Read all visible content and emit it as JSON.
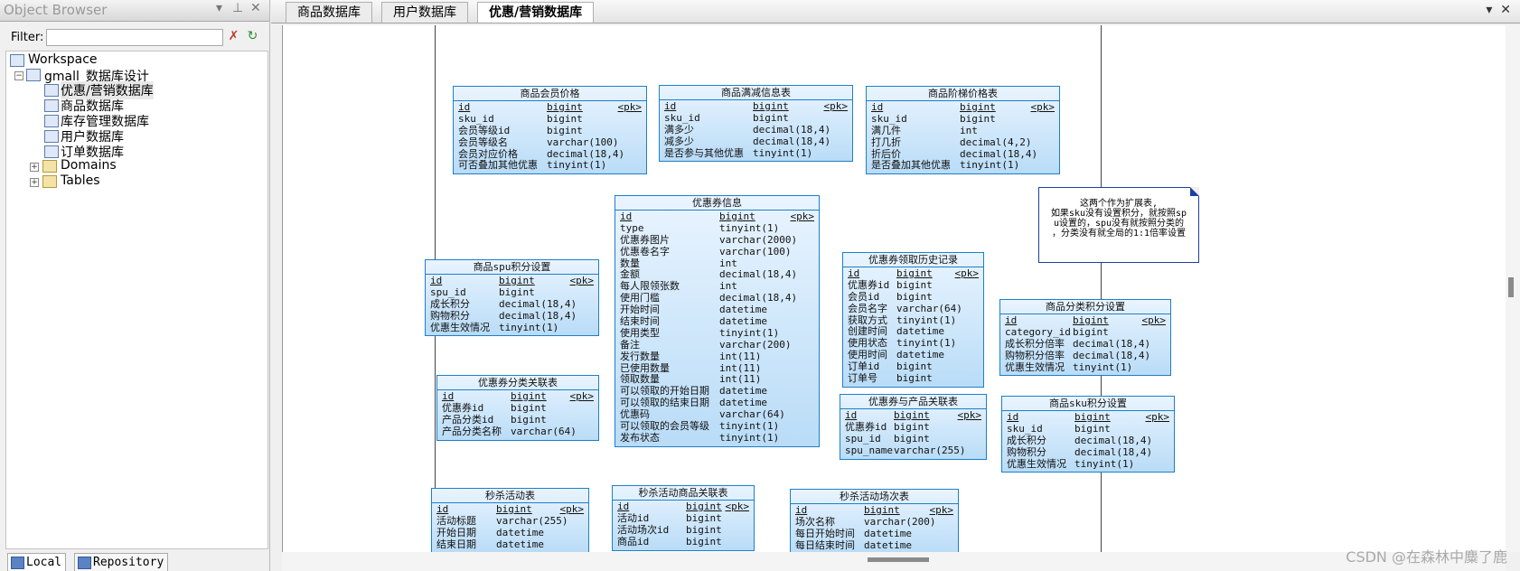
{
  "object_browser": {
    "title": "Object Browser",
    "pin_icon": "pin-icon",
    "filter_label": "Filter:",
    "filter_value": "",
    "tree": [
      {
        "label": "Workspace"
      },
      {
        "label": "gmall_数据库设计"
      },
      {
        "label": "优惠/营销数据库"
      },
      {
        "label": "商品数据库"
      },
      {
        "label": "库存管理数据库"
      },
      {
        "label": "用户数据库"
      },
      {
        "label": "订单数据库"
      },
      {
        "label": "Domains"
      },
      {
        "label": "Tables"
      }
    ],
    "bottom_tabs": [
      "Local",
      "Repository"
    ]
  },
  "editor_tabs": [
    "商品数据库",
    "用户数据库",
    "优惠/营销数据库"
  ],
  "tables": [
    {
      "title": "商品会员价格",
      "rows": [
        [
          "id",
          "bigint",
          "<pk>"
        ],
        [
          "sku_id",
          "bigint",
          ""
        ],
        [
          "会员等级id",
          "bigint",
          ""
        ],
        [
          "会员等级名",
          "varchar(100)",
          ""
        ],
        [
          "会员对应价格",
          "decimal(18,4)",
          ""
        ],
        [
          "可否叠加其他优惠",
          "tinyint(1)",
          ""
        ]
      ]
    },
    {
      "title": "商品满减信息表",
      "rows": [
        [
          "id",
          "bigint",
          "<pk>"
        ],
        [
          "sku_id",
          "bigint",
          ""
        ],
        [
          "满多少",
          "decimal(18,4)",
          ""
        ],
        [
          "减多少",
          "decimal(18,4)",
          ""
        ],
        [
          "是否参与其他优惠",
          "tinyint(1)",
          ""
        ]
      ]
    },
    {
      "title": "商品阶梯价格表",
      "rows": [
        [
          "id",
          "bigint",
          "<pk>"
        ],
        [
          "sku_id",
          "bigint",
          ""
        ],
        [
          "满几件",
          "int",
          ""
        ],
        [
          "打几折",
          "decimal(4,2)",
          ""
        ],
        [
          "折后价",
          "decimal(18,4)",
          ""
        ],
        [
          "是否叠加其他优惠",
          "tinyint(1)",
          ""
        ]
      ]
    },
    {
      "title": "优惠券信息",
      "rows": [
        [
          "id",
          "bigint",
          "<pk>"
        ],
        [
          "type",
          "tinyint(1)",
          ""
        ],
        [
          "优惠券图片",
          "varchar(2000)",
          ""
        ],
        [
          "优惠卷名字",
          "varchar(100)",
          ""
        ],
        [
          "数量",
          "int",
          ""
        ],
        [
          "金额",
          "decimal(18,4)",
          ""
        ],
        [
          "每人限领张数",
          "int",
          ""
        ],
        [
          "使用门槛",
          "decimal(18,4)",
          ""
        ],
        [
          "开始时间",
          "datetime",
          ""
        ],
        [
          "结束时间",
          "datetime",
          ""
        ],
        [
          "使用类型",
          "tinyint(1)",
          ""
        ],
        [
          "备注",
          "varchar(200)",
          ""
        ],
        [
          "发行数量",
          "int(11)",
          ""
        ],
        [
          "已使用数量",
          "int(11)",
          ""
        ],
        [
          "领取数量",
          "int(11)",
          ""
        ],
        [
          "可以领取的开始日期",
          "datetime",
          ""
        ],
        [
          "可以领取的结束日期",
          "datetime",
          ""
        ],
        [
          "优惠码",
          "varchar(64)",
          ""
        ],
        [
          "可以领取的会员等级",
          "tinyint(1)",
          ""
        ],
        [
          "发布状态",
          "tinyint(1)",
          ""
        ]
      ]
    },
    {
      "title": "商品spu积分设置",
      "rows": [
        [
          "id",
          "bigint",
          "<pk>"
        ],
        [
          "spu_id",
          "bigint",
          ""
        ],
        [
          "成长积分",
          "decimal(18,4)",
          ""
        ],
        [
          "购物积分",
          "decimal(18,4)",
          ""
        ],
        [
          "优惠生效情况",
          "tinyint(1)",
          ""
        ]
      ]
    },
    {
      "title": "优惠券领取历史记录",
      "rows": [
        [
          "id",
          "bigint",
          "<pk>"
        ],
        [
          "优惠券id",
          "bigint",
          ""
        ],
        [
          "会员id",
          "bigint",
          ""
        ],
        [
          "会员名字",
          "varchar(64)",
          ""
        ],
        [
          "获取方式",
          "tinyint(1)",
          ""
        ],
        [
          "创建时间",
          "datetime",
          ""
        ],
        [
          "使用状态",
          "tinyint(1)",
          ""
        ],
        [
          "使用时间",
          "datetime",
          ""
        ],
        [
          "订单id",
          "bigint",
          ""
        ],
        [
          "订单号",
          "bigint",
          ""
        ]
      ]
    },
    {
      "title": "商品分类积分设置",
      "rows": [
        [
          "id",
          "bigint",
          "<pk>"
        ],
        [
          "category_id",
          "bigint",
          ""
        ],
        [
          "成长积分倍率",
          "decimal(18,4)",
          ""
        ],
        [
          "购物积分倍率",
          "decimal(18,4)",
          ""
        ],
        [
          "优惠生效情况",
          "tinyint(1)",
          ""
        ]
      ]
    },
    {
      "title": "优惠券分类关联表",
      "rows": [
        [
          "id",
          "bigint",
          "<pk>"
        ],
        [
          "优惠券id",
          "bigint",
          ""
        ],
        [
          "产品分类id",
          "bigint",
          ""
        ],
        [
          "产品分类名称",
          "varchar(64)",
          ""
        ]
      ]
    },
    {
      "title": "优惠券与产品关联表",
      "rows": [
        [
          "id",
          "bigint",
          "<pk>"
        ],
        [
          "优惠券id",
          "bigint",
          ""
        ],
        [
          "spu_id",
          "bigint",
          ""
        ],
        [
          "spu_name",
          "varchar(255)",
          ""
        ]
      ]
    },
    {
      "title": "商品sku积分设置",
      "rows": [
        [
          "id",
          "bigint",
          "<pk>"
        ],
        [
          "sku_id",
          "bigint",
          ""
        ],
        [
          "成长积分",
          "decimal(18,4)",
          ""
        ],
        [
          "购物积分",
          "decimal(18,4)",
          ""
        ],
        [
          "优惠生效情况",
          "tinyint(1)",
          ""
        ]
      ]
    },
    {
      "title": "秒杀活动表",
      "rows": [
        [
          "id",
          "bigint",
          "<pk>"
        ],
        [
          "活动标题",
          "varchar(255)",
          ""
        ],
        [
          "开始日期",
          "datetime",
          ""
        ],
        [
          "结束日期",
          "datetime",
          ""
        ]
      ]
    },
    {
      "title": "秒杀活动商品关联表",
      "rows": [
        [
          "id",
          "bigint",
          "<pk>"
        ],
        [
          "活动id",
          "bigint",
          ""
        ],
        [
          "活动场次id",
          "bigint",
          ""
        ],
        [
          "商品id",
          "bigint",
          ""
        ]
      ]
    },
    {
      "title": "秒杀活动场次表",
      "rows": [
        [
          "id",
          "bigint",
          "<pk>"
        ],
        [
          "场次名称",
          "varchar(200)",
          ""
        ],
        [
          "每日开始时间",
          "datetime",
          ""
        ],
        [
          "每日结束时间",
          "datetime",
          ""
        ]
      ]
    }
  ],
  "note": {
    "lines": [
      "这两个作为扩展表,",
      "如果sku没有设置积分，就按照sp",
      "u设置的，spu没有就按照分类的",
      "，分类没有就全局的1:1倍率设置"
    ]
  },
  "watermark": "CSDN @在森林中麋了鹿"
}
